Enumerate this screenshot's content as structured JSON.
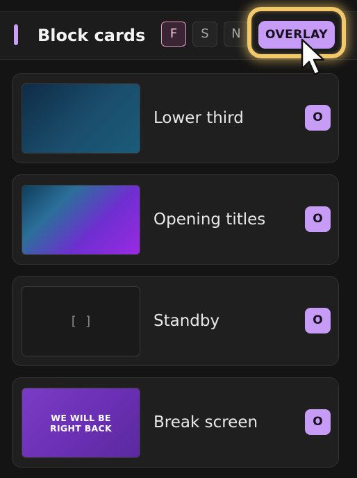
{
  "header": {
    "title": "Block cards",
    "modes": [
      {
        "label": "F",
        "active": true
      },
      {
        "label": "S",
        "active": false
      },
      {
        "label": "N",
        "active": false
      }
    ],
    "overlay_label": "OVERLAY"
  },
  "cards": [
    {
      "label": "Lower third",
      "thumb": "gradient-blue",
      "badge": "O"
    },
    {
      "label": "Opening titles",
      "thumb": "gradient-blue-purple",
      "badge": "O"
    },
    {
      "label": "Standby",
      "thumb": "empty",
      "thumb_icon": "[ ]",
      "badge": "O"
    },
    {
      "label": "Break screen",
      "thumb": "gradient-purple",
      "thumb_text_1": "WE WILL BE",
      "thumb_text_2": "RIGHT BACK",
      "badge": "O"
    }
  ],
  "colors": {
    "accent": "#c79cf7",
    "active_mode_border": "#e89ac0",
    "highlight_glow": "#f1c86a"
  }
}
